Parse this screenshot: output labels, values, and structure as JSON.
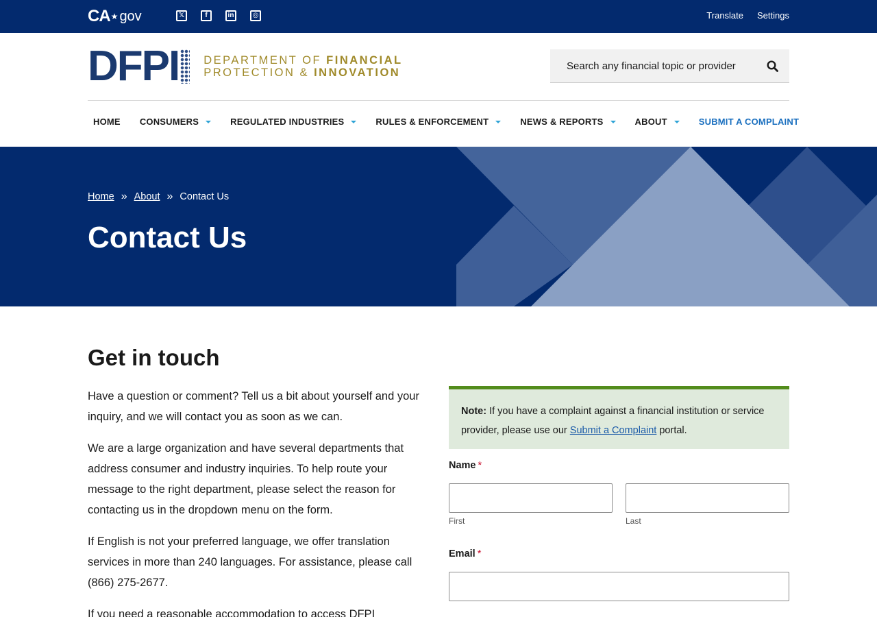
{
  "utility": {
    "logo_ca": "CA",
    "logo_gov": "gov",
    "social": [
      {
        "icon": "x-twitter-icon",
        "glyph": "𝕏"
      },
      {
        "icon": "facebook-icon",
        "glyph": "f"
      },
      {
        "icon": "linkedin-icon",
        "glyph": "in"
      },
      {
        "icon": "instagram-icon",
        "glyph": "◎"
      }
    ],
    "translate": "Translate",
    "settings": "Settings"
  },
  "header": {
    "logo_mark": "DFPI",
    "logo_line1_a": "DEPARTMENT OF ",
    "logo_line1_b": "FINANCIAL",
    "logo_line2_a": "PROTECTION & ",
    "logo_line2_b": "INNOVATION",
    "search_placeholder": "Search any financial topic or provider"
  },
  "nav": {
    "items": [
      {
        "label": "HOME"
      },
      {
        "label": "CONSUMERS"
      },
      {
        "label": "REGULATED INDUSTRIES"
      },
      {
        "label": "RULES & ENFORCEMENT"
      },
      {
        "label": "NEWS & REPORTS"
      },
      {
        "label": "ABOUT"
      },
      {
        "label": "SUBMIT A COMPLAINT"
      }
    ]
  },
  "hero": {
    "breadcrumb": [
      "Home",
      "About",
      "Contact Us"
    ],
    "title": "Contact Us"
  },
  "content": {
    "heading": "Get in touch",
    "paragraphs": [
      "Have a question or comment? Tell us a bit about yourself and your inquiry, and we will contact you as soon as we can.",
      "We are a large organization and have several departments that address consumer and industry inquiries. To help route your message to the right department, please select the reason for contacting us in the dropdown menu on the form.",
      "If English is not your preferred language, we offer translation services in more than 240 languages. For assistance, please call (866) 275-2677.",
      "If you need a reasonable accommodation to access DFPI"
    ],
    "note": {
      "label": "Note:",
      "text_before": " If you have a complaint against a financial institution or service provider, please use our ",
      "link": "Submit a Complaint",
      "text_after": " portal."
    },
    "form": {
      "name_label": "Name",
      "email_label": "Email",
      "required_mark": "*",
      "first_label": "First",
      "last_label": "Last"
    }
  },
  "colors": {
    "primary": "#032a6e",
    "accent": "#2fa3d6",
    "note_bg": "#dfeadc",
    "note_border": "#538c1c",
    "logo_gold": "#a08a2a"
  }
}
